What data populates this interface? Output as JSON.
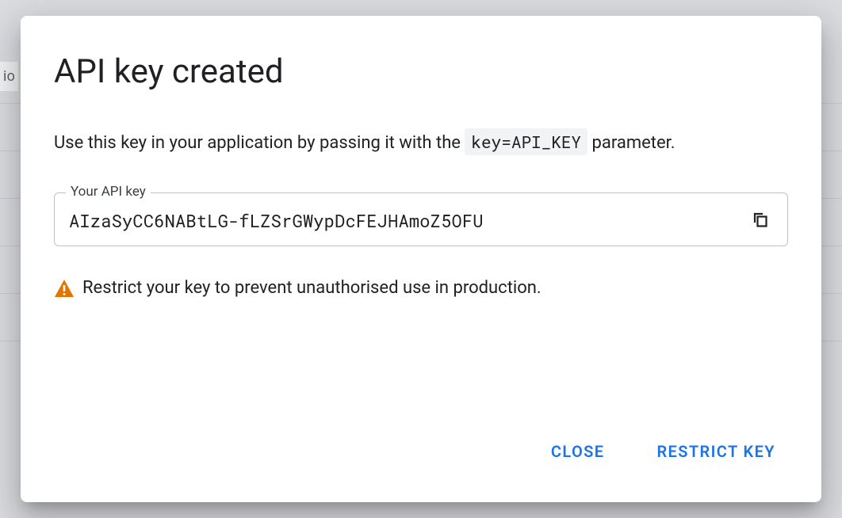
{
  "background": {
    "fragment": "io"
  },
  "dialog": {
    "title": "API key created",
    "description_pre": "Use this key in your application by passing it with the ",
    "description_code": "key=API_KEY",
    "description_post": " parameter.",
    "key_field": {
      "label": "Your API key",
      "value": "AIzaSyCC6NABtLG-fLZSrGWypDcFEJHAmoZ5OFU"
    },
    "warning": "Restrict your key to prevent unauthorised use in production.",
    "actions": {
      "close": "CLOSE",
      "restrict": "RESTRICT KEY"
    },
    "colors": {
      "primary": "#1a73e8",
      "warning_icon": "#e37400"
    }
  }
}
